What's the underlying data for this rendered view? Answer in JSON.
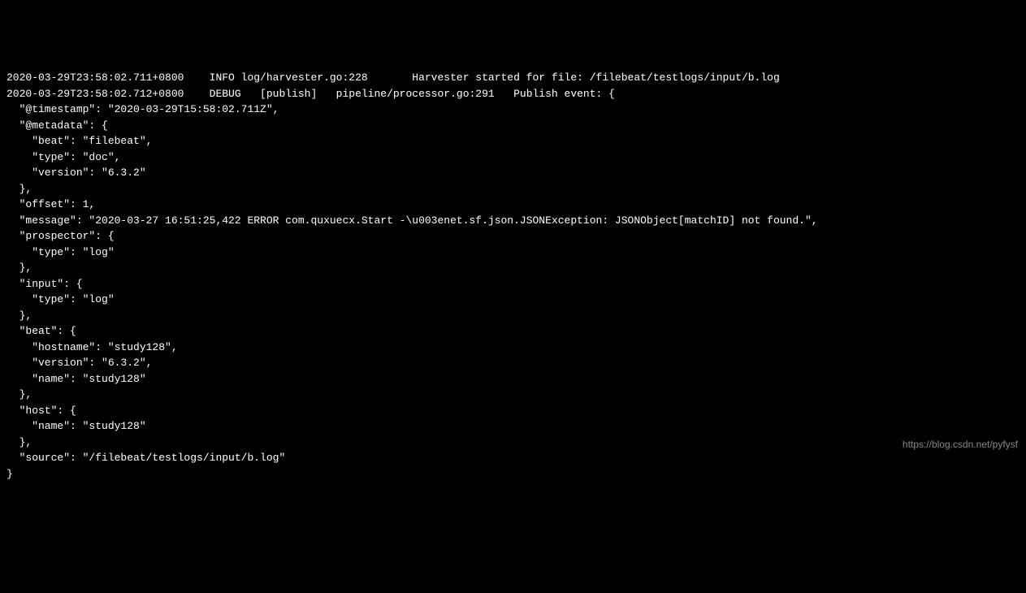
{
  "terminal": {
    "line1": "2020-03-29T23:58:02.711+0800    INFO log/harvester.go:228       Harvester started for file: /filebeat/testlogs/input/b.log",
    "line2": "2020-03-29T23:58:02.712+0800    DEBUG   [publish]   pipeline/processor.go:291   Publish event: {",
    "line3": "  \"@timestamp\": \"2020-03-29T15:58:02.711Z\",",
    "line4": "  \"@metadata\": {",
    "line5": "    \"beat\": \"filebeat\",",
    "line6": "    \"type\": \"doc\",",
    "line7": "    \"version\": \"6.3.2\"",
    "line8": "  },",
    "line9": "  \"offset\": 1,",
    "line10": "  \"message\": \"2020-03-27 16:51:25,422 ERROR com.quxuecx.Start -\\u003enet.sf.json.JSONException: JSONObject[matchID] not found.\",",
    "line11": "  \"prospector\": {",
    "line12": "    \"type\": \"log\"",
    "line13": "  },",
    "line14": "  \"input\": {",
    "line15": "    \"type\": \"log\"",
    "line16": "  },",
    "line17": "  \"beat\": {",
    "line18": "    \"hostname\": \"study128\",",
    "line19": "    \"version\": \"6.3.2\",",
    "line20": "    \"name\": \"study128\"",
    "line21": "  },",
    "line22": "  \"host\": {",
    "line23": "    \"name\": \"study128\"",
    "line24": "  },",
    "line25": "  \"source\": \"/filebeat/testlogs/input/b.log\"",
    "line26": "}"
  },
  "watermark": "https://blog.csdn.net/pyfysf"
}
